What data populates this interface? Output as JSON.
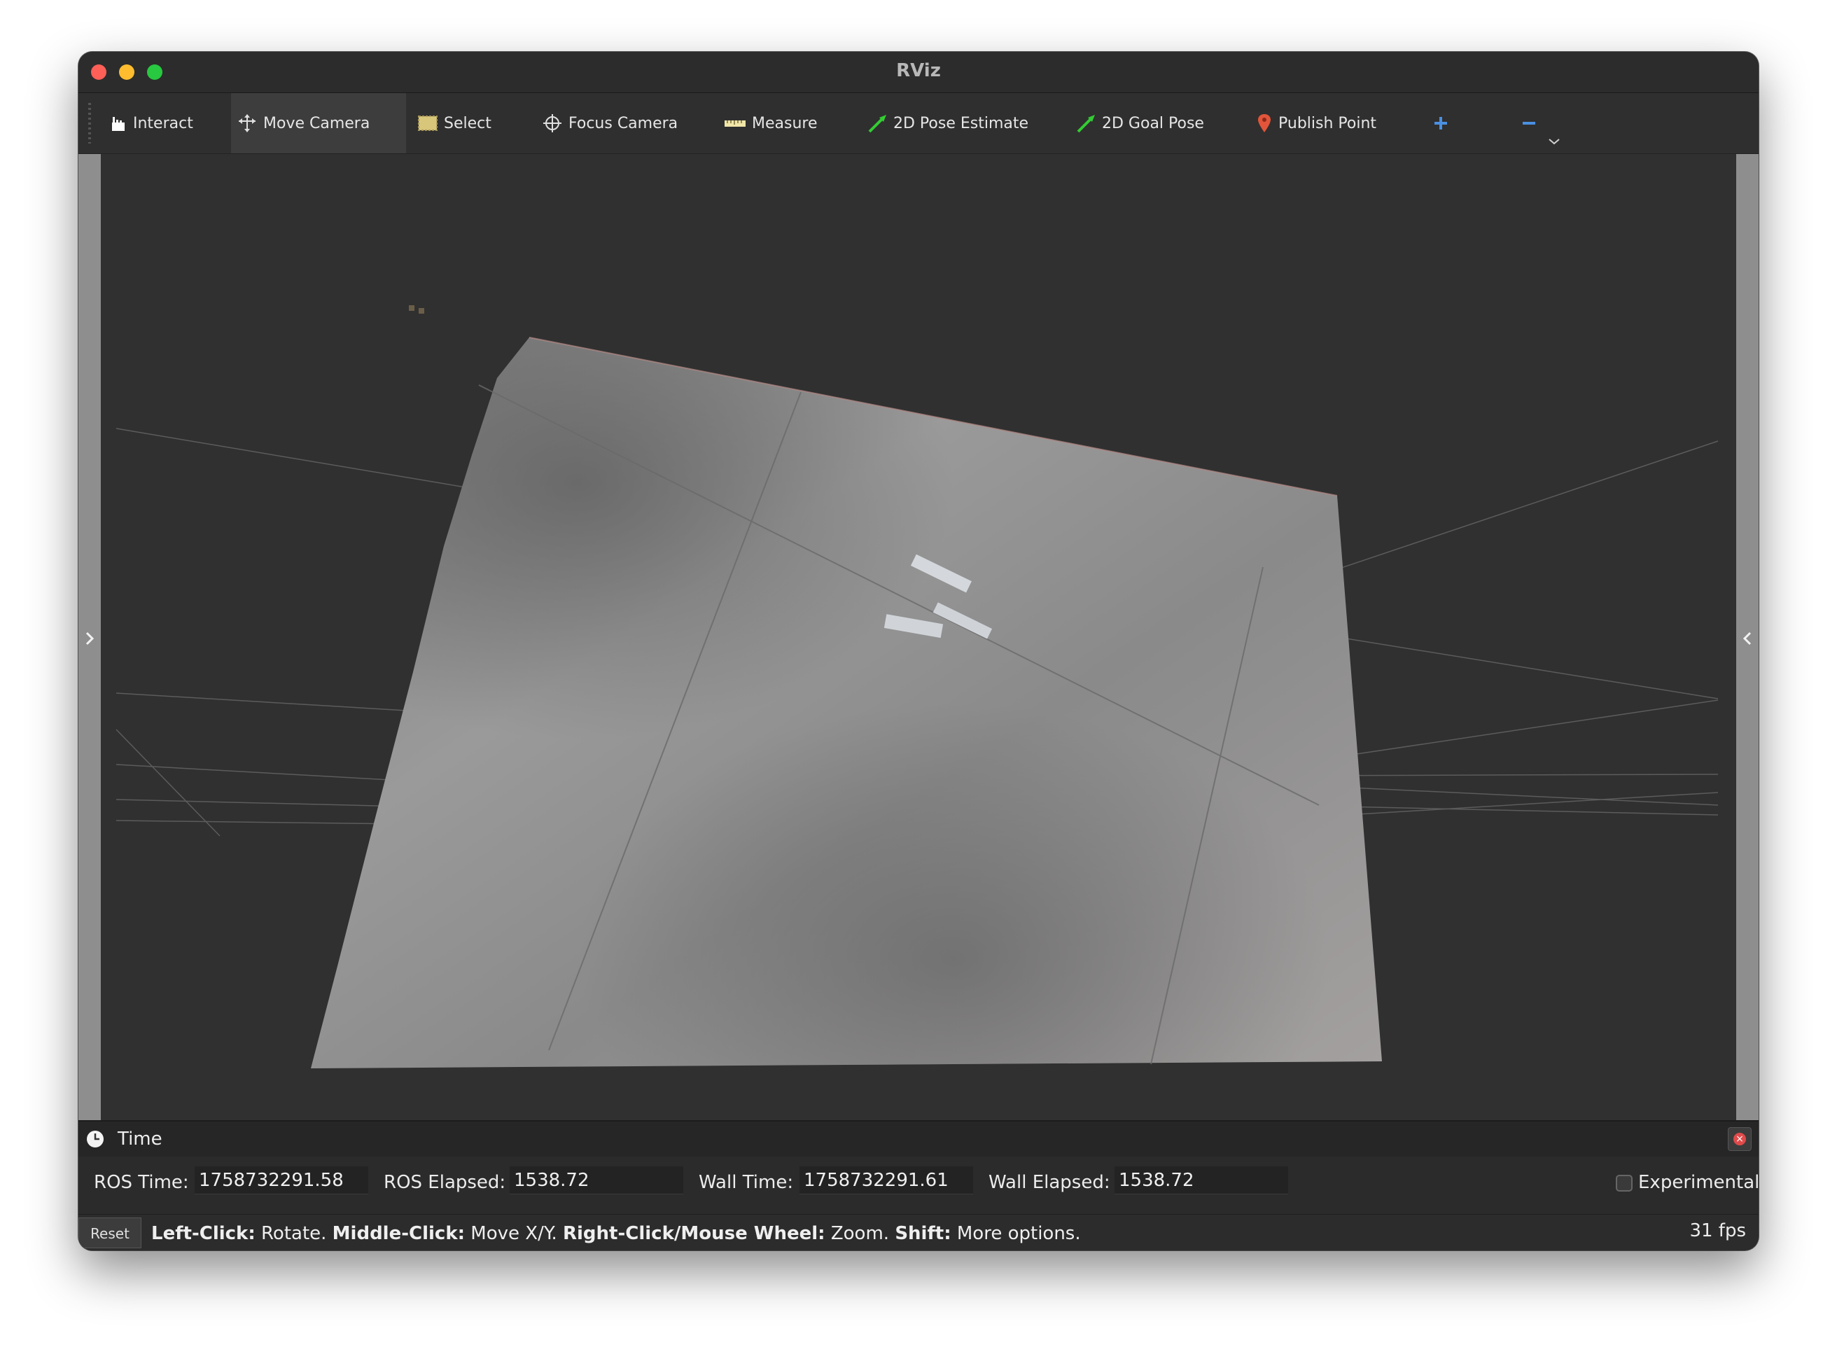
{
  "window": {
    "title": "RViz"
  },
  "toolbar": {
    "tools": [
      {
        "label": "Interact",
        "icon": "hand-cursor-icon"
      },
      {
        "label": "Move Camera",
        "icon": "move-arrows-icon",
        "active": true
      },
      {
        "label": "Select",
        "icon": "select-box-icon"
      },
      {
        "label": "Focus Camera",
        "icon": "crosshair-icon"
      },
      {
        "label": "Measure",
        "icon": "ruler-icon"
      },
      {
        "label": "2D Pose Estimate",
        "icon": "green-arrow-icon"
      },
      {
        "label": "2D Goal Pose",
        "icon": "green-arrow-icon"
      },
      {
        "label": "Publish Point",
        "icon": "map-pin-icon"
      }
    ],
    "add_icon": "plus-icon",
    "remove_icon": "minus-icon"
  },
  "time_panel": {
    "title": "Time",
    "ros_time_label": "ROS Time:",
    "ros_time": "1758732291.58",
    "ros_elapsed_label": "ROS Elapsed:",
    "ros_elapsed": "1538.72",
    "wall_time_label": "Wall Time:",
    "wall_time": "1758732291.61",
    "wall_elapsed_label": "Wall Elapsed:",
    "wall_elapsed": "1538.72",
    "experimental_label": "Experimental",
    "experimental_checked": false
  },
  "status_bar": {
    "reset_label": "Reset",
    "hint_1_bold": "Left-Click:",
    "hint_1": " Rotate. ",
    "hint_2_bold": "Middle-Click:",
    "hint_2": " Move X/Y. ",
    "hint_3_bold": "Right-Click/Mouse Wheel:",
    "hint_3": " Zoom. ",
    "hint_4_bold": "Shift:",
    "hint_4": " More options.",
    "fps": "31 fps"
  },
  "colors": {
    "accent_green": "#28c840",
    "pose_green": "#33cc33",
    "pin_red": "#e2553a",
    "plus_blue": "#4a90e2"
  }
}
